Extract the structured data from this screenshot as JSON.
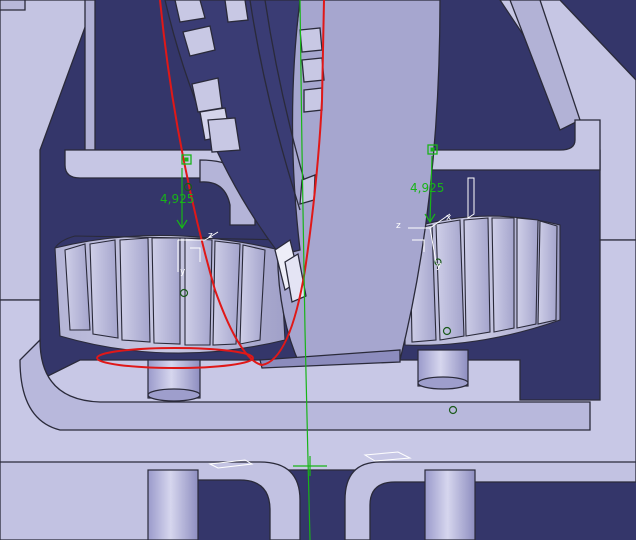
{
  "viewport": {
    "background": "#34366a",
    "part_color": "#c9c9e6",
    "part_shade": "#a9a9cf",
    "edge_color": "#2a2a3a",
    "highlight_color": "#e01818",
    "constraint_color": "#18b418"
  },
  "annotations": {
    "left_dimension": "4,925",
    "right_dimension": "4,925"
  },
  "axes": {
    "left": {
      "x_label": "z",
      "y_label": "y"
    },
    "right": {
      "x_label": "x",
      "z_label": "z",
      "y_label": "y"
    }
  },
  "icons": [
    "anchor-point-icon",
    "anchor-point-icon",
    "axis-triad-icon",
    "axis-triad-icon"
  ]
}
